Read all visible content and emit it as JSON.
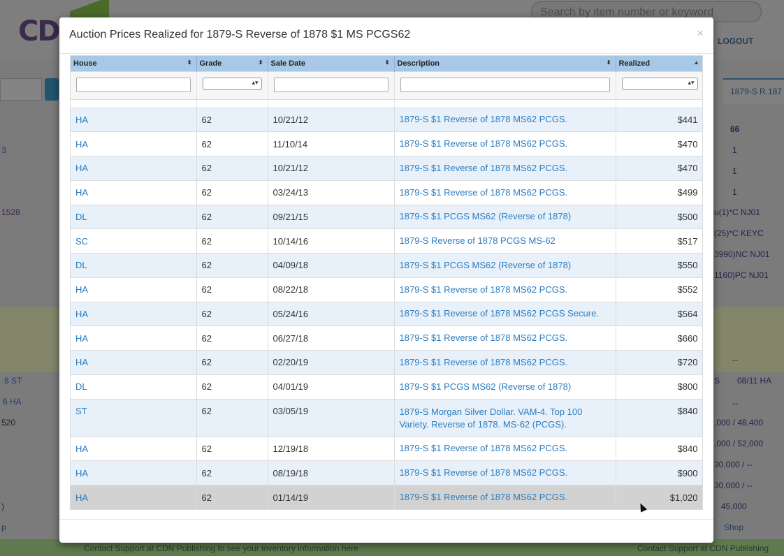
{
  "background": {
    "search_placeholder": "Search by item number or keyword",
    "logout_label": "LOGOUT",
    "right_tab_label": "1879-S R.187",
    "right_col_header": "66",
    "right_col_values": [
      "1",
      "1",
      "1"
    ],
    "right_codes": [
      "u(1)*C NJ01",
      "(25)*C KEYC",
      "3990)NC NJ01",
      "1160)PC NJ01"
    ],
    "right_lower": [
      "--",
      "S",
      "08/11 HA",
      "--",
      ",000 / 48,400",
      ",000 / 52,000",
      "30,000 / --",
      "30,000 / --",
      "45,000",
      "Shop"
    ],
    "left_values": [
      "3",
      "1528",
      "8 ST",
      "6 HA",
      "520",
      ")",
      "p"
    ],
    "footer_left": "Contact Support at CDN Publishing to see your inventory information here",
    "footer_right": "Contact Support at CDN Publishing"
  },
  "modal": {
    "title": "Auction Prices Realized for 1879-S Reverse of 1878 $1 MS PCGS62",
    "close_label": "×",
    "columns": [
      "House",
      "Grade",
      "Sale Date",
      "Description",
      "Realized"
    ],
    "sort_icons": [
      "⬍",
      "⬍",
      "⬍",
      "⬍",
      "▲"
    ],
    "rows": [
      {
        "house": "HA",
        "grade": "62",
        "date": "10/21/12",
        "description": "1879-S $1 Reverse of 1878 MS62 PCGS.",
        "realized": "$441"
      },
      {
        "house": "HA",
        "grade": "62",
        "date": "11/10/14",
        "description": "1879-S $1 Reverse of 1878 MS62 PCGS.",
        "realized": "$470"
      },
      {
        "house": "HA",
        "grade": "62",
        "date": "10/21/12",
        "description": "1879-S $1 Reverse of 1878 MS62 PCGS.",
        "realized": "$470"
      },
      {
        "house": "HA",
        "grade": "62",
        "date": "03/24/13",
        "description": "1879-S $1 Reverse of 1878 MS62 PCGS.",
        "realized": "$499"
      },
      {
        "house": "DL",
        "grade": "62",
        "date": "09/21/15",
        "description": "1879-S $1 PCGS MS62 (Reverse of 1878)",
        "realized": "$500"
      },
      {
        "house": "SC",
        "grade": "62",
        "date": "10/14/16",
        "description": "1879-S Reverse of 1878 PCGS MS-62",
        "realized": "$517"
      },
      {
        "house": "DL",
        "grade": "62",
        "date": "04/09/18",
        "description": "1879-S $1 PCGS MS62 (Reverse of 1878)",
        "realized": "$550"
      },
      {
        "house": "HA",
        "grade": "62",
        "date": "08/22/18",
        "description": "1879-S $1 Reverse of 1878 MS62 PCGS.",
        "realized": "$552"
      },
      {
        "house": "HA",
        "grade": "62",
        "date": "05/24/16",
        "description": "1879-S $1 Reverse of 1878 MS62 PCGS Secure.",
        "realized": "$564"
      },
      {
        "house": "HA",
        "grade": "62",
        "date": "06/27/18",
        "description": "1879-S $1 Reverse of 1878 MS62 PCGS.",
        "realized": "$660"
      },
      {
        "house": "HA",
        "grade": "62",
        "date": "02/20/19",
        "description": "1879-S $1 Reverse of 1878 MS62 PCGS.",
        "realized": "$720"
      },
      {
        "house": "DL",
        "grade": "62",
        "date": "04/01/19",
        "description": "1879-S $1 PCGS MS62 (Reverse of 1878)",
        "realized": "$800"
      },
      {
        "house": "ST",
        "grade": "62",
        "date": "03/05/19",
        "description": "1879-S Morgan Silver Dollar. VAM-4. Top 100 Variety. Reverse of 1878. MS-62 (PCGS).",
        "realized": "$840"
      },
      {
        "house": "HA",
        "grade": "62",
        "date": "12/19/18",
        "description": "1879-S $1 Reverse of 1878 MS62 PCGS.",
        "realized": "$840"
      },
      {
        "house": "HA",
        "grade": "62",
        "date": "08/19/18",
        "description": "1879-S $1 Reverse of 1878 MS62 PCGS.",
        "realized": "$900"
      },
      {
        "house": "HA",
        "grade": "62",
        "date": "01/14/19",
        "description": "1879-S $1 Reverse of 1878 MS62 PCGS.",
        "realized": "$1,020"
      }
    ]
  }
}
